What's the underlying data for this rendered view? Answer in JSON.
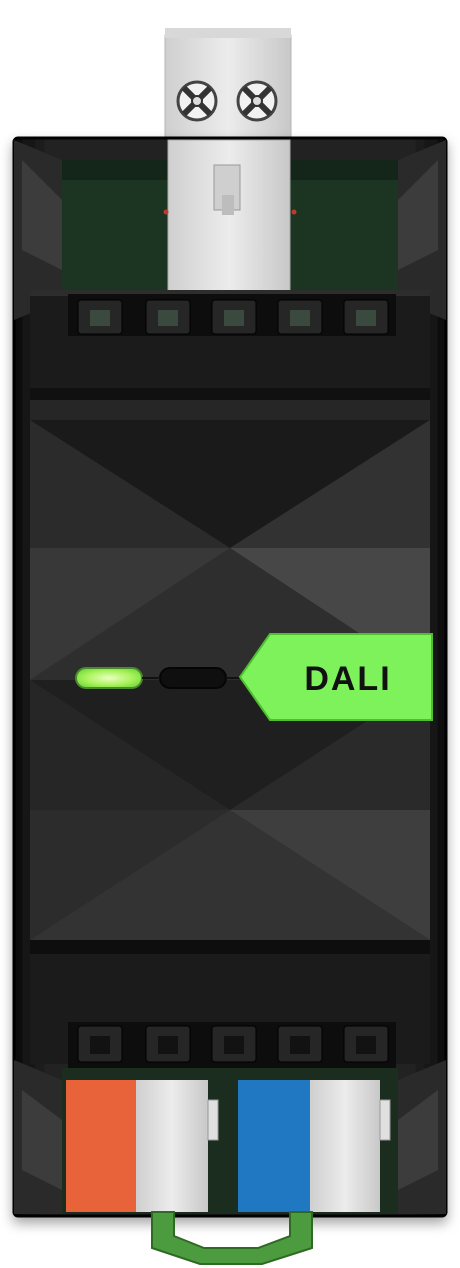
{
  "device": {
    "label": "DALI",
    "colors": {
      "housing": "#1e1e1e",
      "housing_dark": "#141414",
      "housing_light": "#3a3a3a",
      "pcb": "#1f3a25",
      "terminal_top": "#dcdcdc",
      "label_bg": "#7df25a",
      "led_on": "#c9f87a",
      "led_off": "#0f0f0f",
      "wire_orange": "#e8623a",
      "wire_blue": "#1f78c1",
      "terminal_white": "#e4e4e4",
      "din_clip": "#4d9b3f"
    },
    "icons": {
      "top_screws": "screw-icon",
      "bottom_clip": "din-rail-clip-icon"
    },
    "leds": [
      {
        "name": "status-led",
        "state": "on"
      },
      {
        "name": "error-led",
        "state": "off"
      }
    ]
  }
}
